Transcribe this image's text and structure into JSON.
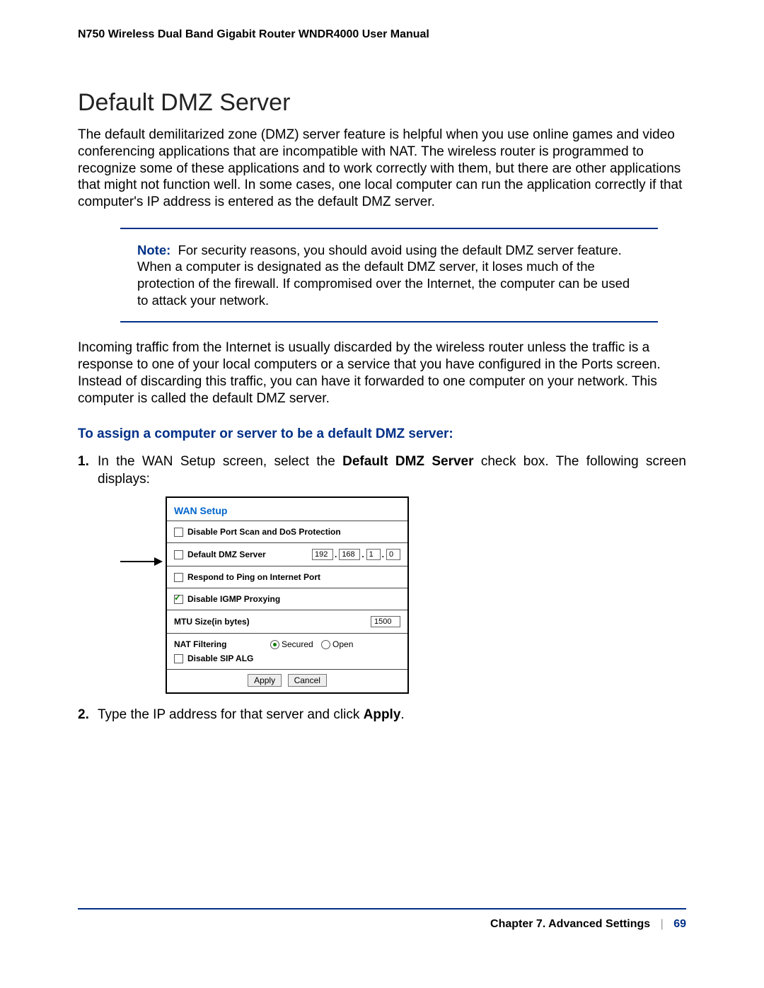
{
  "header": "N750 Wireless Dual Band Gigabit Router WNDR4000 User Manual",
  "section_title": "Default DMZ Server",
  "para1": "The default demilitarized zone (DMZ) server feature is helpful when you use online games and video conferencing applications that are incompatible with NAT. The wireless router is programmed to recognize some of these applications and to work correctly with them, but there are other applications that might not function well. In some cases, one local computer can run the application correctly if that computer's IP address is entered as the default DMZ server.",
  "note_label": "Note:",
  "note_text": "For security reasons, you should avoid using the default DMZ server feature. When a computer is designated as the default DMZ server, it loses much of the protection of the firewall. If compromised over the Internet, the computer can be used to attack your network.",
  "para2": "Incoming traffic from the Internet is usually discarded by the wireless router unless the traffic is a response to one of your local computers or a service that you have configured in the Ports screen. Instead of discarding this traffic, you can have it forwarded to one computer on your network. This computer is called the default DMZ server.",
  "subhead": "To assign a computer or server to be a default DMZ server:",
  "step1_pre": "In the WAN Setup screen, select the ",
  "step1_bold": "Default DMZ Server",
  "step1_post": " check box. The following screen displays:",
  "step2_pre": "Type the IP address for that server and click ",
  "step2_bold": "Apply",
  "step2_post": ".",
  "wan": {
    "title": "WAN Setup",
    "disable_scan": "Disable Port Scan and DoS Protection",
    "default_dmz": "Default DMZ Server",
    "ip": [
      "192",
      "168",
      "1",
      "0"
    ],
    "respond_ping": "Respond to Ping on Internet Port",
    "disable_igmp": "Disable IGMP Proxying",
    "mtu_label": "MTU Size(in bytes)",
    "mtu_value": "1500",
    "nat_label": "NAT Filtering",
    "nat_secured": "Secured",
    "nat_open": "Open",
    "disable_sip": "Disable SIP ALG",
    "btn_apply": "Apply",
    "btn_cancel": "Cancel"
  },
  "footer": {
    "chapter": "Chapter 7.  Advanced Settings",
    "page": "69"
  }
}
